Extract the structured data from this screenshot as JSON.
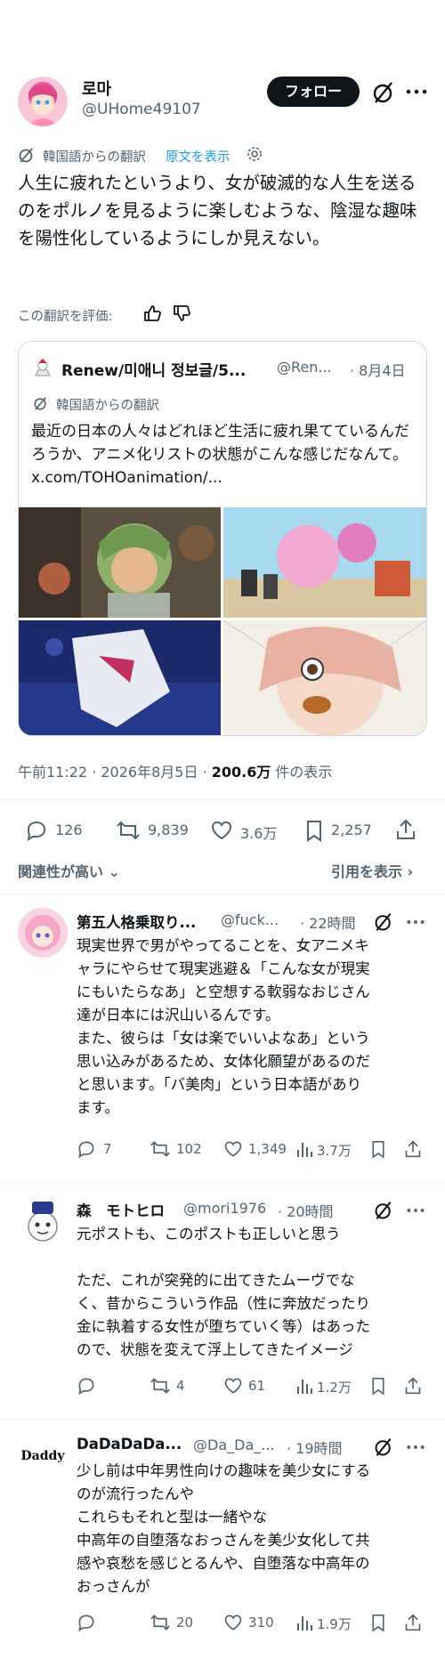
{
  "post": {
    "author_name": "로마",
    "author_handle": "@UHome49107",
    "follow_label": "フォロー",
    "translation_label": "韓国語からの翻訳",
    "show_original_label": "原文を表示",
    "body": "人生に疲れたというより、女が破滅的な人生を送るのをポルノを見るように楽しむような、陰湿な趣味を陽性化しているようにしか見えない。",
    "rate_translation_label": "この翻訳を評価:",
    "timestamp": "午前11:22 · 2026年8月5日 · ",
    "views_value": "200.6万",
    "views_label": " 件の表示",
    "stats": {
      "replies": "126",
      "reposts": "9,839",
      "likes": "3.6万",
      "bookmarks": "2,257"
    }
  },
  "quote": {
    "author_name": "Renew/미애니 정보글/5...",
    "author_handle": "@Ren...",
    "date": "· 8月4日",
    "translation_label": "韓国語からの翻訳",
    "body": "最近の日本の人々はどれほど生活に疲れ果てているんだろうか、アニメ化リストの状態がこんな感じだなんて。 x.com/TOHOanimation/..."
  },
  "sort": {
    "relevance_label": "関連性が高い",
    "quotes_label": "引用を表示"
  },
  "replies": [
    {
      "name": "第五人格乗取り...",
      "handle": "@fuck...",
      "time": "· 22時間",
      "lines": [
        "現実世界で男がやってることを、女アニメキ",
        "ャラにやらせて現実逃避＆「こんな女が現実",
        "にもいたらなあ」と空想する軟弱なおじさん",
        "達が日本には沢山いるんです。",
        "また、彼らは「女は楽でいいよなあ」という",
        "思い込みがあるため、女体化願望があるのだ",
        "と思います。「バ美肉」という日本語があり",
        "ます。"
      ],
      "stats": {
        "replies": "7",
        "reposts": "102",
        "likes": "1,349",
        "views": "3.7万"
      }
    },
    {
      "name": "森　モトヒロ",
      "handle": "@mori1976",
      "time": "· 20時間",
      "lines": [
        "元ポストも、このポストも正しいと思う",
        "",
        "ただ、これが突発的に出てきたムーヴでな",
        "く、昔からこういう作品（性に奔放だったり",
        "金に執着する女性が堕ちていく等）はあった",
        "ので、状態を変えて浮上してきたイメージ"
      ],
      "stats": {
        "replies": "",
        "reposts": "4",
        "likes": "61",
        "views": "1.2万"
      }
    },
    {
      "name": "DaDaDaDa...",
      "handle": "@Da_Da_...",
      "time": "· 19時間",
      "avatar_text": "Daddy",
      "lines": [
        "少し前は中年男性向けの趣味を美少女にする",
        "のが流行ったんや",
        "これらもそれと型は一緒やな",
        "中高年の自堕落なおっさんを美少女化して共",
        "感や哀愁を感じとるんや、自堕落な中高年の",
        "おっさんが"
      ],
      "stats": {
        "replies": "",
        "reposts": "20",
        "likes": "310",
        "views": "1.9万"
      }
    }
  ],
  "colors": {
    "accent": "#1d9bf0",
    "text": "#0f1419",
    "muted": "#536471",
    "border": "#cfd9de"
  }
}
